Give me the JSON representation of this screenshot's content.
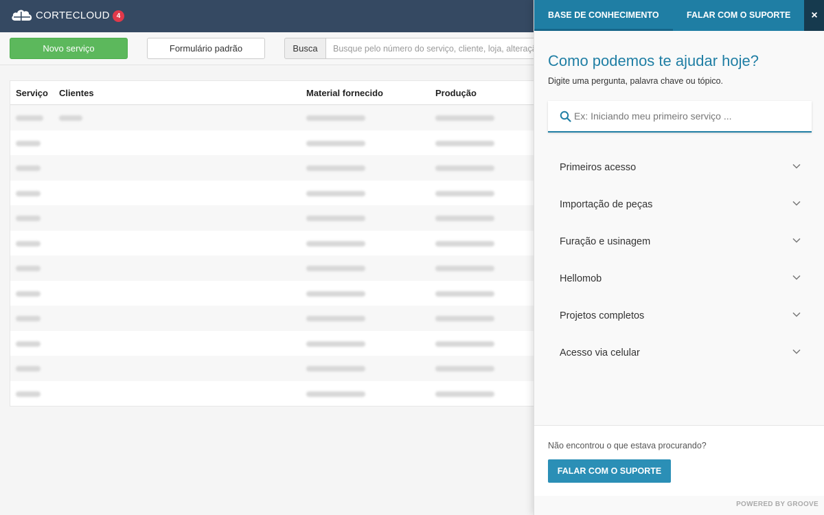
{
  "app": {
    "logo_text": "CORTECLOUD",
    "notification_count": "4"
  },
  "toolbar": {
    "new_service_label": "Novo serviço",
    "default_form_label": "Formulário padrão",
    "search_addon": "Busca",
    "search_placeholder": "Busque pelo número do serviço, cliente, loja, alteração"
  },
  "table": {
    "headers": [
      "Serviço",
      "Clientes",
      "Material fornecido",
      "Produção"
    ],
    "row_count": 12,
    "note_rows_blurred": true
  },
  "help_panel": {
    "tabs": [
      {
        "label": "BASE DE CONHECIMENTO",
        "active": true
      },
      {
        "label": "FALAR COM O SUPORTE",
        "active": false
      }
    ],
    "close_label": "×",
    "title": "Como podemos te ajudar hoje?",
    "subtitle": "Digite uma pergunta, palavra chave ou tópico.",
    "search_placeholder": "Ex: Iniciando meu primeiro serviço ...",
    "categories": [
      {
        "label": "Primeiros acesso"
      },
      {
        "label": "Importação de peças"
      },
      {
        "label": "Furação e usinagem"
      },
      {
        "label": "Hellomob"
      },
      {
        "label": "Projetos completos"
      },
      {
        "label": "Acesso via celular"
      }
    ],
    "footer_question": "Não encontrou o que estava procurando?",
    "footer_button": "FALAR COM O SUPORTE",
    "powered_by": "POWERED BY GROOVE"
  },
  "colors": {
    "topbar": "#354962",
    "accent": "#1f7ea4",
    "success": "#5cb85c",
    "badge": "#e0394a"
  },
  "icons": {
    "logo": "cloud-icon",
    "search": "search-icon",
    "chevron": "chevron-down-icon",
    "close": "close-icon"
  }
}
